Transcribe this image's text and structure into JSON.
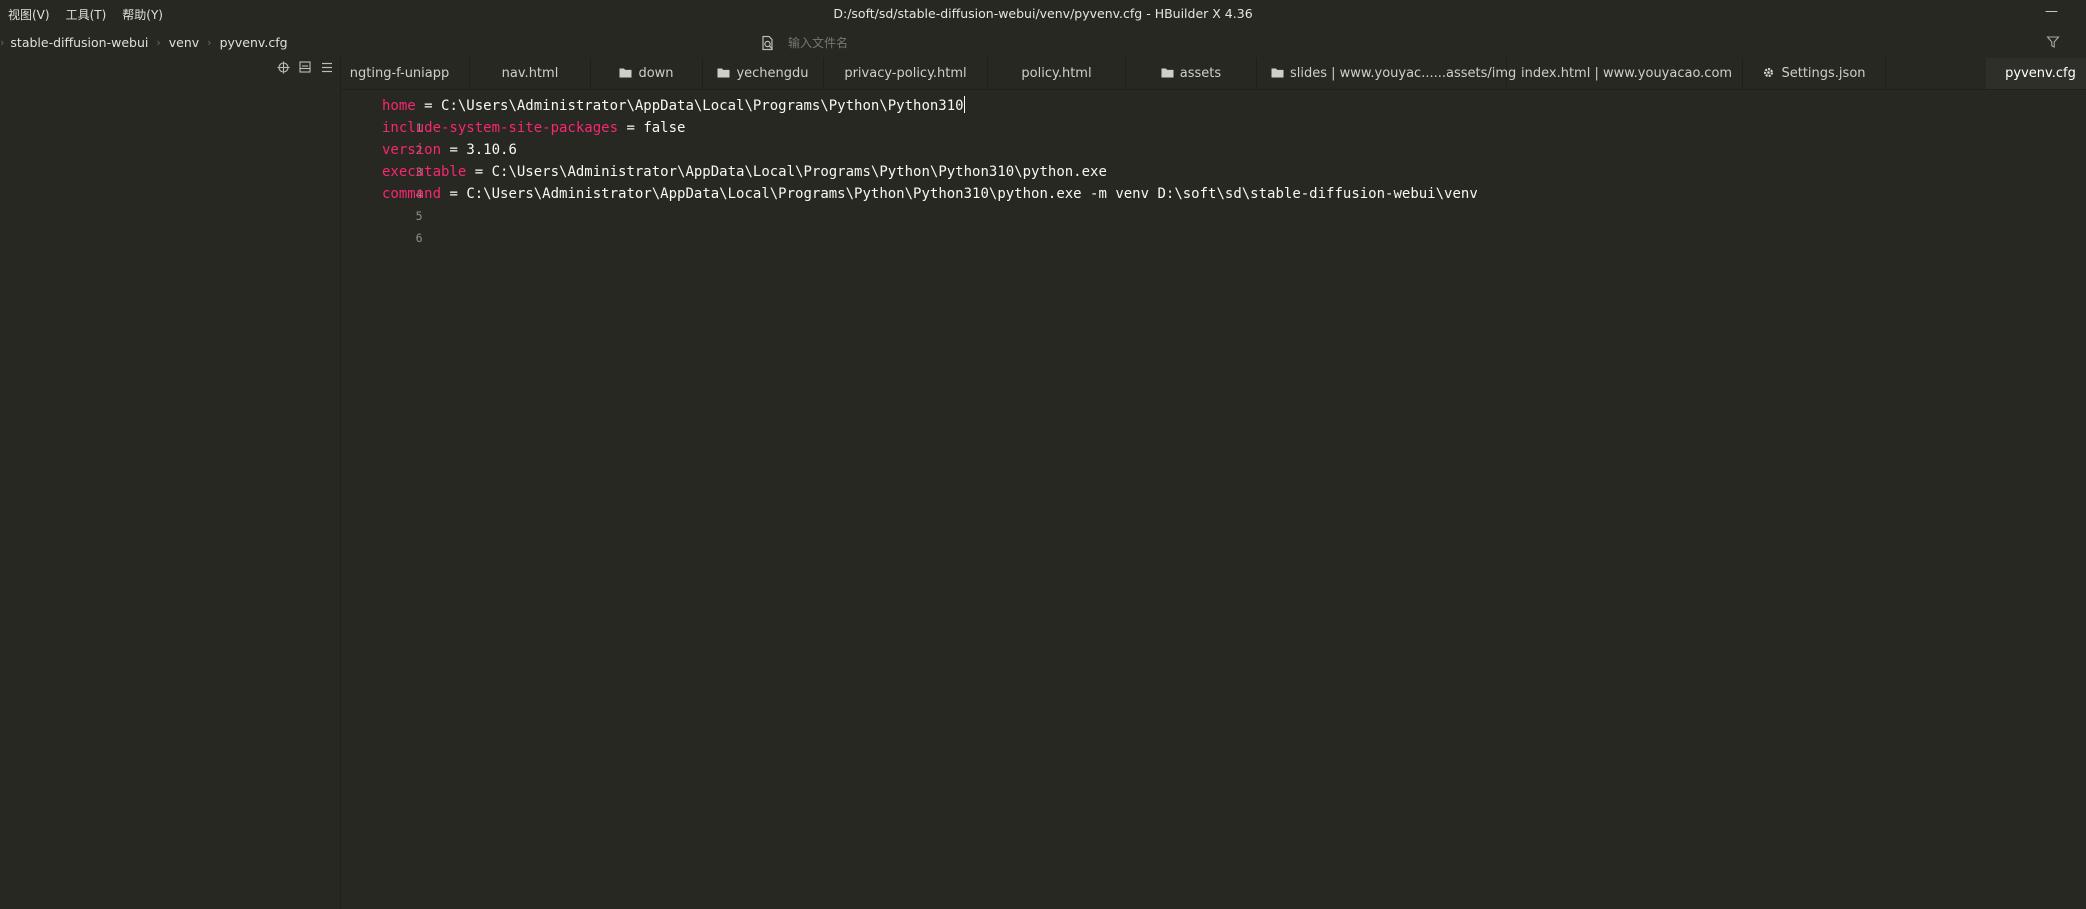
{
  "menu": {
    "items": [
      "视图(V)",
      "工具(T)",
      "帮助(Y)"
    ]
  },
  "window": {
    "title": "D:/soft/sd/stable-diffusion-webui/venv/pyvenv.cfg - HBuilder X 4.36",
    "minimize_glyph": "—"
  },
  "breadcrumb": {
    "items": [
      "stable-diffusion-webui",
      "venv",
      "pyvenv.cfg"
    ]
  },
  "search": {
    "placeholder": "输入文件名"
  },
  "tabs": [
    {
      "label": "ngting-f-uniapp",
      "icon": "none"
    },
    {
      "label": "nav.html",
      "icon": "none"
    },
    {
      "label": "down",
      "icon": "folder-icon"
    },
    {
      "label": "yechengdu",
      "icon": "folder-icon"
    },
    {
      "label": "privacy-policy.html",
      "icon": "none"
    },
    {
      "label": "policy.html",
      "icon": "none"
    },
    {
      "label": "assets",
      "icon": "folder-icon"
    },
    {
      "label": "slides | www.youyac......assets/img",
      "icon": "folder-icon"
    },
    {
      "label": "index.html | www.youyacao.com",
      "icon": "none"
    },
    {
      "label": "Settings.json",
      "icon": "gear-icon"
    },
    {
      "label": "pyvenv.cfg",
      "icon": "none",
      "active": true
    }
  ],
  "editor": {
    "lines": [
      {
        "num": "1",
        "key": "home",
        "op": " = ",
        "value": "C:\\Users\\Administrator\\AppData\\Local\\Programs\\Python\\Python310"
      },
      {
        "num": "2",
        "key": "include-system-site-packages",
        "op": " = ",
        "value": "false"
      },
      {
        "num": "3",
        "key": "version",
        "op": " = ",
        "value": "3.10.6"
      },
      {
        "num": "4",
        "key": "executable",
        "op": " = ",
        "value": "C:\\Users\\Administrator\\AppData\\Local\\Programs\\Python\\Python310\\python.exe"
      },
      {
        "num": "5",
        "key": "command",
        "op": " = ",
        "value": "C:\\Users\\Administrator\\AppData\\Local\\Programs\\Python\\Python310\\python.exe -m venv D:\\soft\\sd\\stable-diffusion-webui\\venv"
      },
      {
        "num": "6",
        "key": "",
        "op": "",
        "value": ""
      }
    ]
  },
  "colors": {
    "background": "#272822",
    "keyword": "#f92672",
    "text": "#f8f8f2",
    "line_number": "#8f908a"
  }
}
